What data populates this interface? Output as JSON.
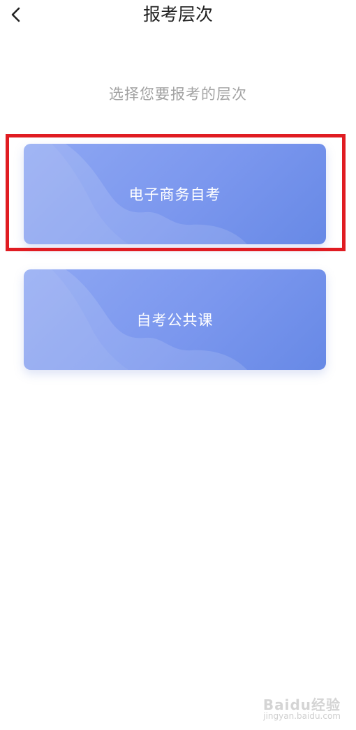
{
  "header": {
    "title": "报考层次",
    "back_icon": "chevron-left-icon"
  },
  "main": {
    "subtitle": "选择您要报考的层次",
    "options": [
      {
        "label": "电子商务自考",
        "highlighted": true
      },
      {
        "label": "自考公共课",
        "highlighted": false
      }
    ]
  },
  "colors": {
    "card_gradient_start": "#8ea7f3",
    "card_gradient_end": "#6789e6",
    "highlight_border": "#e01c22",
    "subtitle_text": "#a3a3a3",
    "title_text": "#222222"
  },
  "watermark": {
    "brand": "Baidu经验",
    "url": "jingyan.baidu.com"
  }
}
